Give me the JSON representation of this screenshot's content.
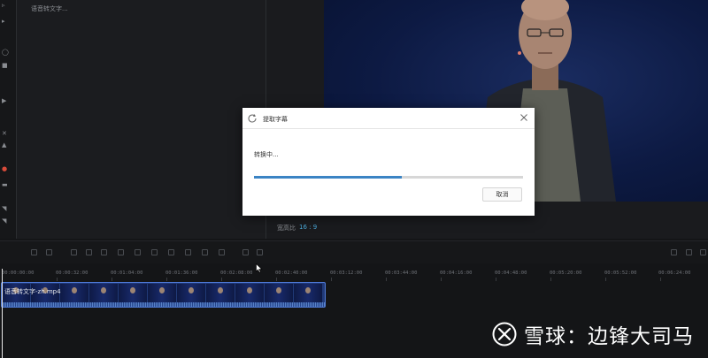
{
  "sidebar": {
    "icons": [
      "sidebar-glyph"
    ]
  },
  "text_panel": {
    "placeholder": "语音转文字..."
  },
  "preview": {
    "aspect_label": "宽高比",
    "aspect_value": "16 : 9"
  },
  "timeline": {
    "time_marks": [
      "00:00:00:00",
      "00:00:32:00",
      "00:01:04:00",
      "00:01:36:00",
      "00:02:08:00",
      "00:02:40:00",
      "00:03:12:00",
      "00:03:44:00",
      "00:04:16:00",
      "00:04:48:00",
      "00:05:20:00",
      "00:05:52:00",
      "00:06:24:00"
    ],
    "clip_title": "语音转文字-zh.mp4"
  },
  "dialog": {
    "title": "提取字幕",
    "status": "转换中...",
    "progress": 0.55,
    "cancel_label": "取消"
  },
  "watermark": {
    "text": "雪球：边锋大司马"
  },
  "colors": {
    "accent": "#3b84c4",
    "clip_bg": "#213a78",
    "aspect": "#4aa8d8"
  }
}
